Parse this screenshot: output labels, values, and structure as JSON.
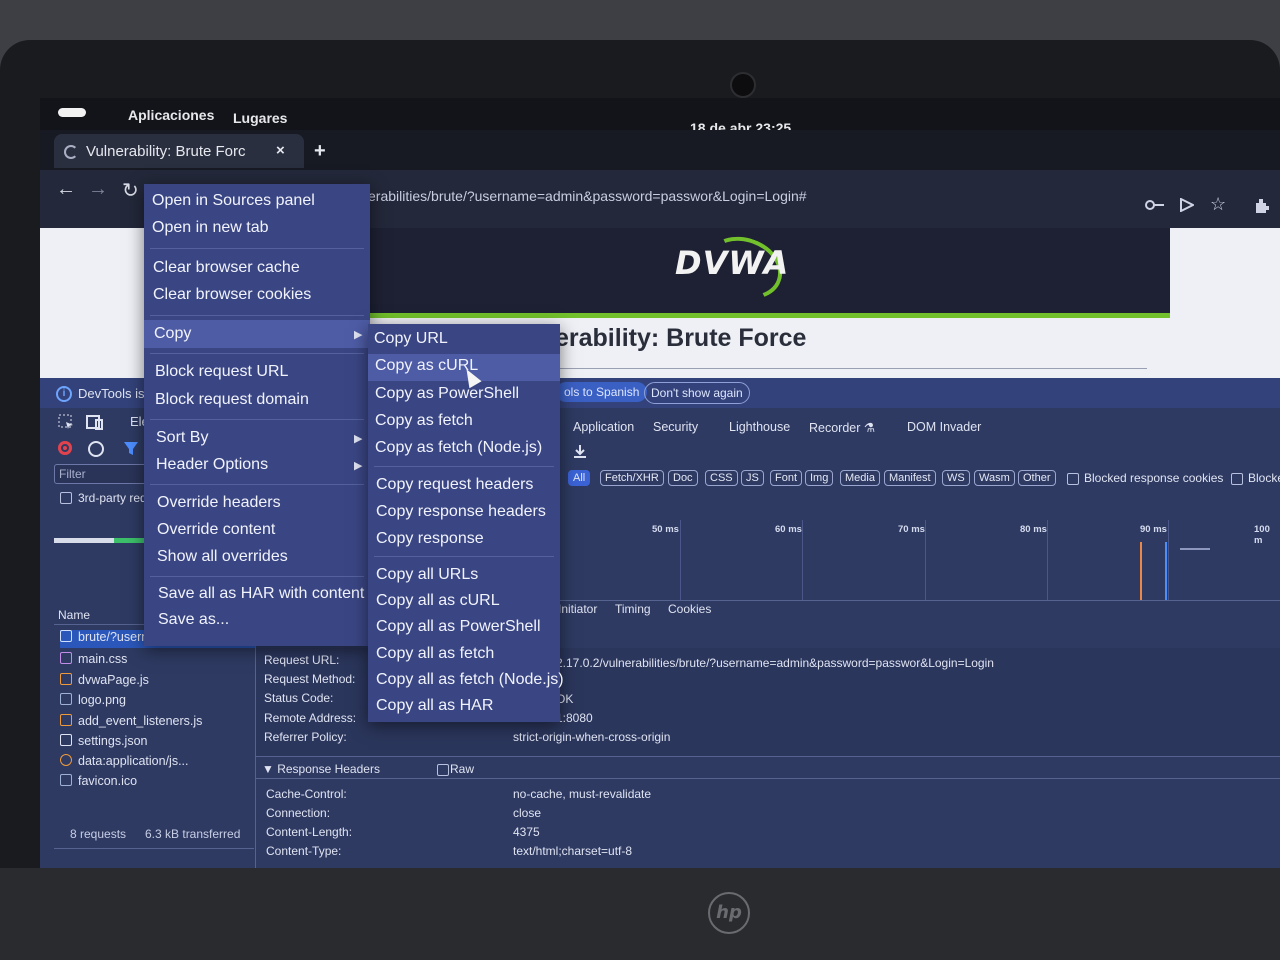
{
  "desktop": {
    "menu_apps": "Aplicaciones",
    "menu_places": "Lugares",
    "clock": "18 de abr  23:25"
  },
  "browser": {
    "tab_title": "Vulnerability: Brute Forc",
    "tab_close": "×",
    "new_tab": "+",
    "back": "←",
    "forward": "→",
    "reload": "↻",
    "url": "erabilities/brute/?username=admin&password=passwor&Login=Login#"
  },
  "page": {
    "logo": "DVWA",
    "title": "erability: Brute Force"
  },
  "devtools": {
    "notice": "DevTools is",
    "switch_lang": "ols to Spanish",
    "dont_show": "Don't show again",
    "elements_tab": "Ele",
    "filter_placeholder": "Filter",
    "third_party": "3rd-party req",
    "panels": [
      "Application",
      "Security",
      "Lighthouse",
      "Recorder ⚗",
      "DOM Invader"
    ],
    "filter_chips": [
      "All",
      "Fetch/XHR",
      "Doc",
      "CSS",
      "JS",
      "Font",
      "Img",
      "Media",
      "Manifest",
      "WS",
      "Wasm",
      "Other"
    ],
    "blocked_cookies": "Blocked response cookies",
    "blocked_req": "Blocke",
    "timeline_labels": [
      "50 ms",
      "60 ms",
      "70 ms",
      "80 ms",
      "90 ms",
      "100 m"
    ],
    "detail_tabs": [
      "Initiator",
      "Timing",
      "Cookies"
    ],
    "name_header": "Name",
    "requests": [
      {
        "name": "brute/?userna",
        "icon": "doc-icon"
      },
      {
        "name": "main.css",
        "icon": "css-icon"
      },
      {
        "name": "dvwaPage.js",
        "icon": "js-icon"
      },
      {
        "name": "logo.png",
        "icon": "image-icon"
      },
      {
        "name": "add_event_listeners.js",
        "icon": "js-icon"
      },
      {
        "name": "settings.json",
        "icon": "file-icon"
      },
      {
        "name": "data:application/js...",
        "icon": "script-icon"
      },
      {
        "name": "favicon.ico",
        "icon": "image-icon"
      }
    ],
    "summary_requests": "8 requests",
    "summary_transferred": "6.3 kB transferred",
    "general": [
      {
        "key": "Request URL:",
        "value": "2.17.0.2/vulnerabilities/brute/?username=admin&password=passwor&Login=Login"
      },
      {
        "key": "Request Method:",
        "value": ""
      },
      {
        "key": "Status Code:",
        "value": "OK"
      },
      {
        "key": "Remote Address:",
        "value": "1:8080"
      },
      {
        "key": "Referrer Policy:",
        "value": "strict-origin-when-cross-origin"
      }
    ],
    "response_headers_title": "▼ Response Headers",
    "raw_label": "Raw",
    "response_headers": [
      {
        "key": "Cache-Control:",
        "value": "no-cache, must-revalidate"
      },
      {
        "key": "Connection:",
        "value": "close"
      },
      {
        "key": "Content-Length:",
        "value": "4375"
      },
      {
        "key": "Content-Type:",
        "value": "text/html;charset=utf-8"
      }
    ]
  },
  "context_menu": {
    "items": [
      "Open in Sources panel",
      "Open in new tab",
      "Clear browser cache",
      "Clear browser cookies",
      "Copy",
      "Block request URL",
      "Block request domain",
      "Sort By",
      "Header Options",
      "Override headers",
      "Override content",
      "Show all overrides",
      "Save all as HAR with content",
      "Save as..."
    ]
  },
  "copy_submenu": {
    "items": [
      "Copy URL",
      "Copy as cURL",
      "Copy as PowerShell",
      "Copy as fetch",
      "Copy as fetch (Node.js)",
      "Copy request headers",
      "Copy response headers",
      "Copy response",
      "Copy all URLs",
      "Copy all as cURL",
      "Copy all as PowerShell",
      "Copy all as fetch",
      "Copy all as fetch (Node.js)",
      "Copy all as HAR"
    ]
  },
  "laptop_brand": "hp"
}
